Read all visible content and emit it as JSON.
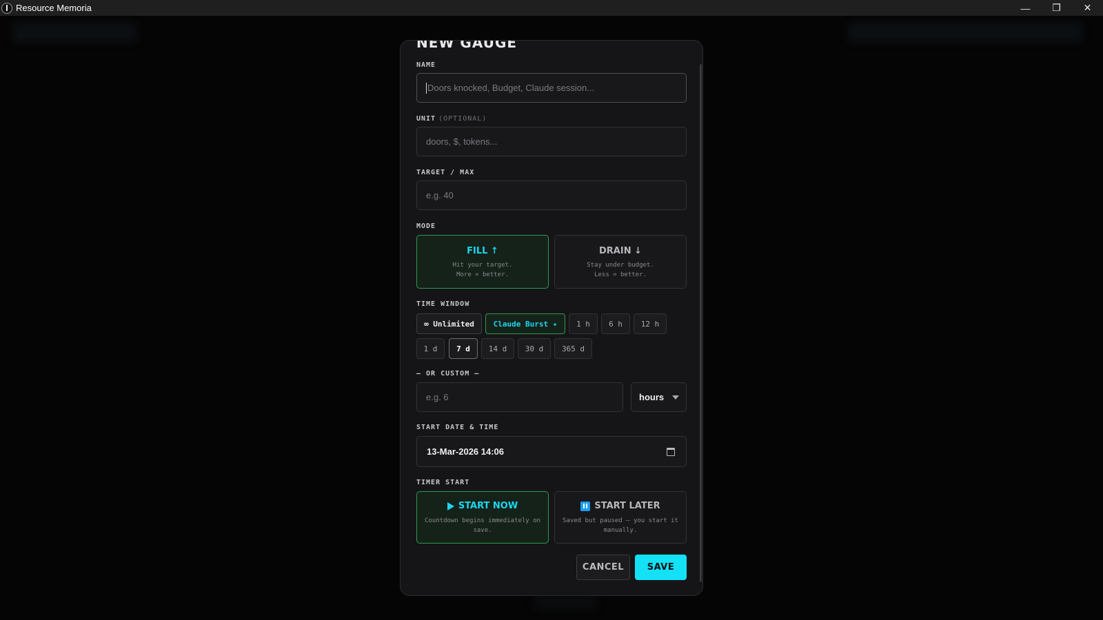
{
  "window": {
    "title": "Resource Memoria",
    "controls": {
      "minimize": "—",
      "maximize": "❐",
      "close": "✕"
    }
  },
  "modal": {
    "title": "NEW GAUGE",
    "name": {
      "label": "NAME",
      "placeholder": "Doors knocked, Budget, Claude session..."
    },
    "unit": {
      "label": "UNIT",
      "optional": "(OPTIONAL)",
      "placeholder": "doors, $, tokens..."
    },
    "target": {
      "label": "TARGET / MAX",
      "placeholder": "e.g. 40"
    },
    "mode": {
      "label": "MODE",
      "selected": "fill",
      "options": [
        {
          "id": "fill",
          "title": "FILL ↑",
          "line1": "Hit your target.",
          "line2": "More = better."
        },
        {
          "id": "drain",
          "title": "DRAIN ↓",
          "line1": "Stay under budget.",
          "line2": "Less = better."
        }
      ]
    },
    "time_window": {
      "label": "TIME WINDOW",
      "chips": [
        "∞ Unlimited",
        "Claude Burst ✦",
        "1 h",
        "6 h",
        "12 h",
        "1 d",
        "7 d",
        "14 d",
        "30 d",
        "365 d"
      ],
      "selected": "7 d"
    },
    "custom": {
      "label": "— OR CUSTOM —",
      "placeholder": "e.g. 6",
      "unit_value": "hours"
    },
    "start": {
      "label": "START DATE & TIME",
      "value": "13-Mar-2026 14:06"
    },
    "timer_start": {
      "label": "TIMER START",
      "selected": "now",
      "options": [
        {
          "id": "now",
          "title": "START NOW",
          "desc": "Countdown begins immediately on save."
        },
        {
          "id": "later",
          "title": "START LATER",
          "desc": "Saved but paused — you start it manually."
        }
      ]
    },
    "buttons": {
      "cancel": "CANCEL",
      "save": "SAVE"
    }
  },
  "colors": {
    "accent": "#1ed6f0",
    "save_bg": "#14e0f6",
    "active_border": "#2f9a4e",
    "pause_icon": "#1a9ff0"
  }
}
